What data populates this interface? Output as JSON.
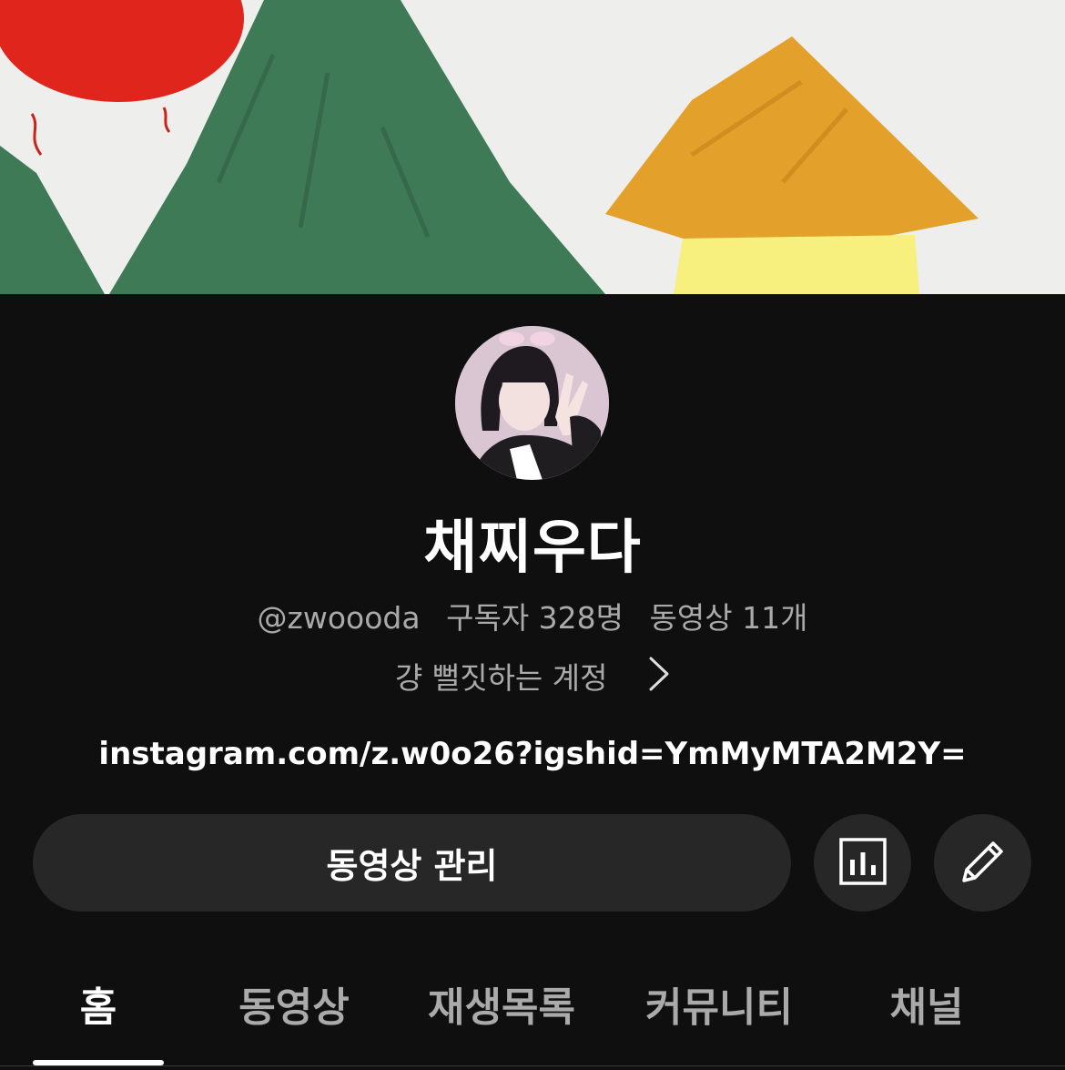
{
  "channel": {
    "name": "채찌우다",
    "handle": "@zwoooda",
    "subscribers": "구독자 328명",
    "videos": "동영상 11개",
    "description": "걍 뻘짓하는 계정",
    "link": "instagram.com/z.w0o26?igshid=YmMyMTA2M2Y="
  },
  "actions": {
    "manage_label": "동영상 관리",
    "analytics_icon": "analytics-chart-icon",
    "edit_icon": "pencil-icon"
  },
  "tabs": [
    {
      "label": "홈",
      "active": true
    },
    {
      "label": "동영상",
      "active": false
    },
    {
      "label": "재생목록",
      "active": false
    },
    {
      "label": "커뮤니티",
      "active": false
    },
    {
      "label": "채널",
      "active": false
    }
  ],
  "colors": {
    "background": "#0f0f0f",
    "button": "#272727",
    "text_primary": "#ffffff",
    "text_secondary": "#aaaaaa"
  }
}
